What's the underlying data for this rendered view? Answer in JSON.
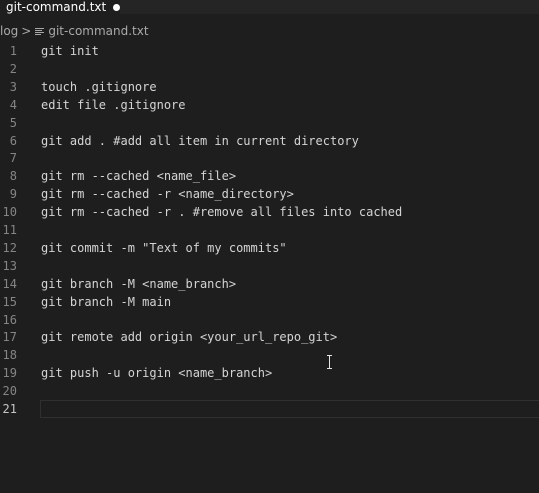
{
  "tab": {
    "title": "git-command.txt",
    "dirty_icon": "unsaved-dot-icon"
  },
  "breadcrumb": {
    "folder": "log",
    "separator": ">",
    "file_icon": "text-file-icon",
    "file": "git-command.txt"
  },
  "editor": {
    "lines": [
      {
        "num": "1",
        "text": "git init"
      },
      {
        "num": "2",
        "text": ""
      },
      {
        "num": "3",
        "text": "touch .gitignore"
      },
      {
        "num": "4",
        "text": "edit file .gitignore"
      },
      {
        "num": "5",
        "text": ""
      },
      {
        "num": "6",
        "text": "git add . #add all item in current directory"
      },
      {
        "num": "7",
        "text": ""
      },
      {
        "num": "8",
        "text": "git rm --cached <name_file>"
      },
      {
        "num": "9",
        "text": "git rm --cached -r <name_directory>"
      },
      {
        "num": "10",
        "text": "git rm --cached -r . #remove all files into cached"
      },
      {
        "num": "11",
        "text": ""
      },
      {
        "num": "12",
        "text": "git commit -m \"Text of my commits\""
      },
      {
        "num": "13",
        "text": ""
      },
      {
        "num": "14",
        "text": "git branch -M <name_branch>"
      },
      {
        "num": "15",
        "text": "git branch -M main"
      },
      {
        "num": "16",
        "text": ""
      },
      {
        "num": "17",
        "text": "git remote add origin <your_url_repo_git>"
      },
      {
        "num": "18",
        "text": ""
      },
      {
        "num": "19",
        "text": "git push -u origin <name_branch>"
      },
      {
        "num": "20",
        "text": ""
      },
      {
        "num": "21",
        "text": ""
      }
    ],
    "active_line": "21"
  },
  "colors": {
    "background": "#1e1e1e",
    "text": "#d4d4d4",
    "line_number": "#858585"
  }
}
